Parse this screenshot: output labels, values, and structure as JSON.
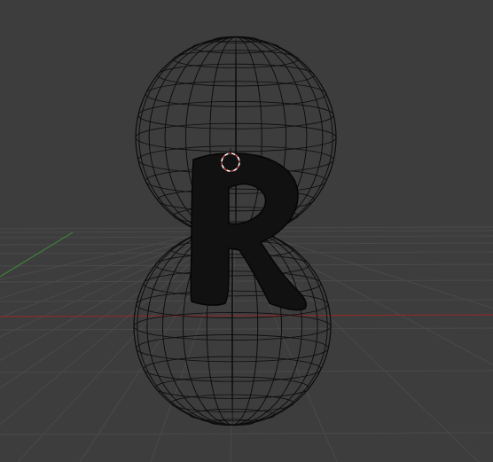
{
  "viewport": {
    "background": "#3d3d3d",
    "grid_color": "#4a4a4a",
    "wire_color": "#0d0d0d",
    "axis_x_color": "#8b2a2a",
    "axis_y_color": "#3f7f3a",
    "cursor_color": "#c85050"
  },
  "scene": {
    "objects": [
      {
        "type": "sphere-wireframe",
        "name": "upper-sphere"
      },
      {
        "type": "sphere-wireframe",
        "name": "lower-sphere"
      },
      {
        "type": "text-mesh",
        "glyph": "R",
        "name": "letter-r-mesh"
      }
    ]
  }
}
